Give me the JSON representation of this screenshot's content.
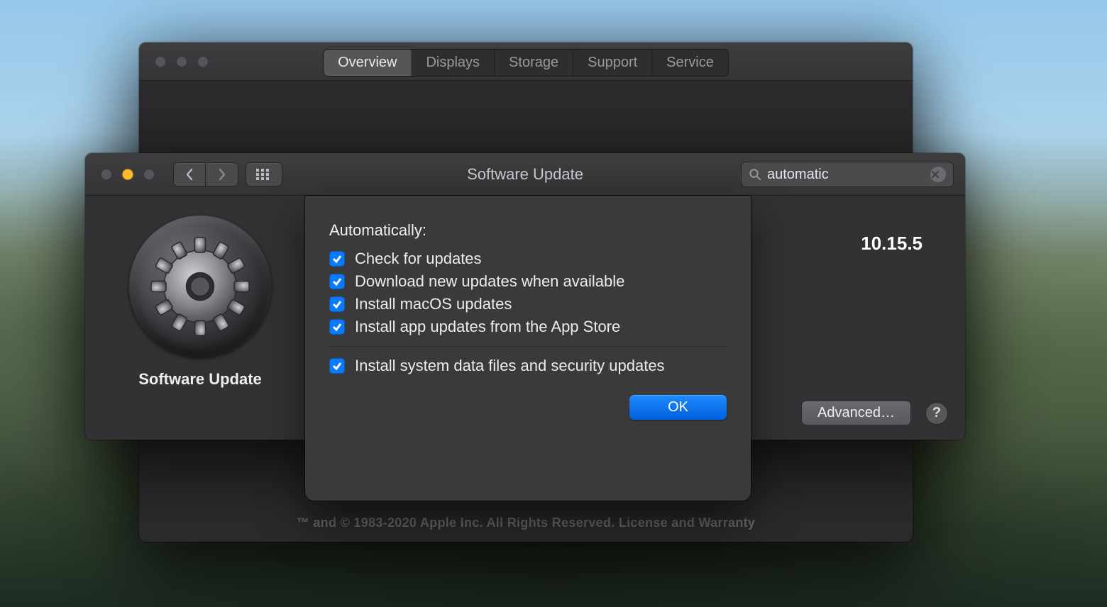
{
  "backWindow": {
    "tabs": [
      "Overview",
      "Displays",
      "Storage",
      "Support",
      "Service"
    ],
    "selectedTab": 0,
    "footer": "™ and © 1983-2020 Apple Inc. All Rights Reserved. License and Warranty"
  },
  "frontWindow": {
    "title": "Software Update",
    "search": {
      "value": "automatic"
    },
    "leftLabel": "Software Update",
    "versionPeek": "10.15.5",
    "advancedLabel": "Advanced…",
    "helpLabel": "?"
  },
  "sheet": {
    "header": "Automatically:",
    "options": [
      {
        "label": "Check for updates",
        "checked": true
      },
      {
        "label": "Download new updates when available",
        "checked": true
      },
      {
        "label": "Install macOS updates",
        "checked": true
      },
      {
        "label": "Install app updates from the App Store",
        "checked": true
      }
    ],
    "afterDivider": [
      {
        "label": "Install system data files and security updates",
        "checked": true
      }
    ],
    "ok": "OK"
  }
}
